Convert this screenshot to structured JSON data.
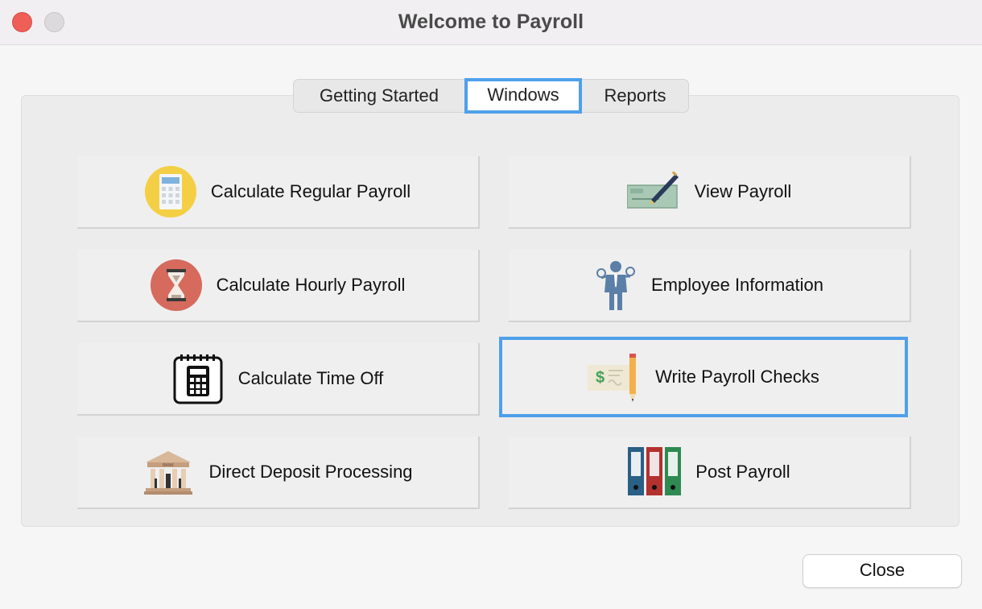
{
  "window": {
    "title": "Welcome to Payroll"
  },
  "tabs": [
    {
      "label": "Getting Started",
      "selected": false
    },
    {
      "label": "Windows",
      "selected": true
    },
    {
      "label": "Reports",
      "selected": false
    }
  ],
  "buttons": {
    "calc_regular": {
      "label": "Calculate Regular Payroll",
      "icon": "calculator-icon"
    },
    "calc_hourly": {
      "label": "Calculate Hourly Payroll",
      "icon": "hourglass-icon"
    },
    "calc_timeoff": {
      "label": "Calculate Time Off",
      "icon": "calendar-calculator-icon"
    },
    "direct_deposit": {
      "label": "Direct Deposit Processing",
      "icon": "bank-icon"
    },
    "view_payroll": {
      "label": "View Payroll",
      "icon": "check-pen-icon"
    },
    "employee_info": {
      "label": "Employee Information",
      "icon": "employee-icon"
    },
    "write_checks": {
      "label": "Write Payroll Checks",
      "icon": "check-pencil-icon",
      "focused": true
    },
    "post_payroll": {
      "label": "Post Payroll",
      "icon": "binders-icon"
    }
  },
  "footer": {
    "close_label": "Close"
  },
  "colors": {
    "focus_ring": "#4ea0ea",
    "close_light": "#ee5f58"
  }
}
